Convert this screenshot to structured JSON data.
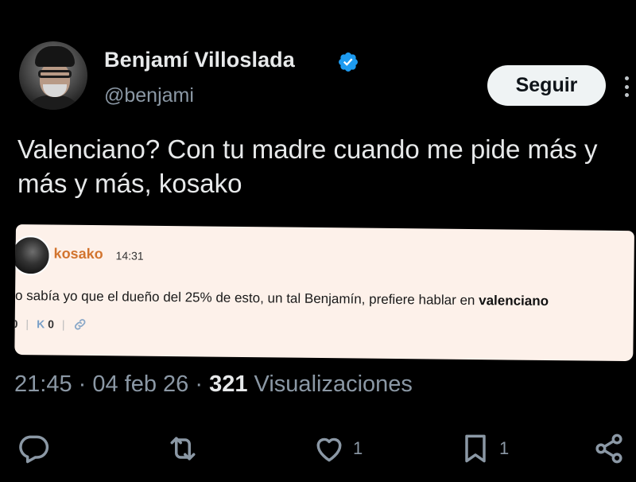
{
  "author": {
    "name": "Benjamí Villoslada",
    "handle": "@benjami",
    "verified": true
  },
  "follow_button": "Seguir",
  "tweet_text": "Valenciano? Con tu madre cuando me pide más y más y más, kosako",
  "embedded_post": {
    "username": "kosako",
    "time": "14:31",
    "text_prefix": "o sabía yo que el dueño del 25% de esto, un tal Benjamín, prefiere hablar en",
    "text_bold": "valenciano",
    "vote_left": "0",
    "ko_label": "K",
    "ko_count": "0"
  },
  "meta": {
    "time": "21:45",
    "date": "04 feb 26",
    "views_count": "321",
    "views_label": "Visualizaciones"
  },
  "actions": {
    "reply_count": "",
    "retweet_count": "",
    "like_count": "1",
    "bookmark_count": "1"
  },
  "colors": {
    "background": "#000000",
    "text": "#e7e9ea",
    "muted": "#8b98a5",
    "verified": "#1d9bf0",
    "embed_bg": "#fdf1ea",
    "embed_user": "#d2742e"
  },
  "icons": [
    "verified-badge-icon",
    "more-icon",
    "link-icon",
    "reply-icon",
    "retweet-icon",
    "like-icon",
    "bookmark-icon",
    "share-icon"
  ]
}
